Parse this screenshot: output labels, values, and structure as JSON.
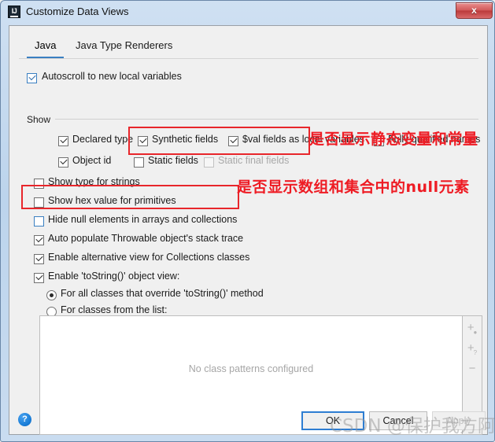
{
  "window": {
    "title": "Customize Data Views",
    "app_icon": "intellij-idea-icon",
    "close_label": "x"
  },
  "tabs": [
    {
      "label": "Java",
      "active": true
    },
    {
      "label": "Java Type Renderers",
      "active": false
    }
  ],
  "top_option": {
    "label": "Autoscroll to new local variables",
    "checked": true
  },
  "show_group": {
    "title": "Show",
    "row1": [
      {
        "label": "Declared type",
        "checked": true,
        "enabled": true
      },
      {
        "label": "Synthetic fields",
        "checked": true,
        "enabled": true
      },
      {
        "label": "$val fields as local variables",
        "checked": true,
        "enabled": true
      },
      {
        "label": "Fully qualified names",
        "checked": false,
        "enabled": true
      }
    ],
    "row2": [
      {
        "label": "Object id",
        "checked": true,
        "enabled": true
      },
      {
        "label": "Static fields",
        "checked": false,
        "enabled": true
      },
      {
        "label": "Static final fields",
        "checked": false,
        "enabled": false
      }
    ]
  },
  "options": [
    {
      "label": "Show type for strings",
      "checked": false
    },
    {
      "label": "Show hex value for primitives",
      "checked": false
    },
    {
      "label": "Hide null elements in arrays and collections",
      "checked": false
    },
    {
      "label": "Auto populate Throwable object's stack trace",
      "checked": true
    },
    {
      "label": "Enable alternative view for Collections classes",
      "checked": true
    },
    {
      "label": "Enable 'toString()' object view:",
      "checked": true
    }
  ],
  "radios": [
    {
      "label": "For all classes that override 'toString()' method",
      "selected": true
    },
    {
      "label": "For classes from the list:",
      "selected": false
    }
  ],
  "list_panel": {
    "empty_text": "No class patterns configured",
    "buttons": [
      {
        "name": "add-pattern-button",
        "glyph": "+",
        "sup": "●"
      },
      {
        "name": "add-pattern-from-query-button",
        "glyph": "+",
        "sup": "?"
      },
      {
        "name": "remove-pattern-button",
        "glyph": "−",
        "sup": ""
      }
    ]
  },
  "footer": {
    "help_label": "?",
    "ok_label": "OK",
    "cancel_label": "Cancel",
    "apply_label": "Apply"
  },
  "annotations": [
    {
      "text": "是否显示静态变量和常量"
    },
    {
      "text": "是否显示数组和集合中的null元素"
    }
  ],
  "watermark": {
    "text": "CSDN @保护我方阿遥"
  },
  "colors": {
    "accent": "#3a7fc1",
    "annotation_red": "#ee1c24",
    "title_gradient_top": "#cfe0f2"
  }
}
